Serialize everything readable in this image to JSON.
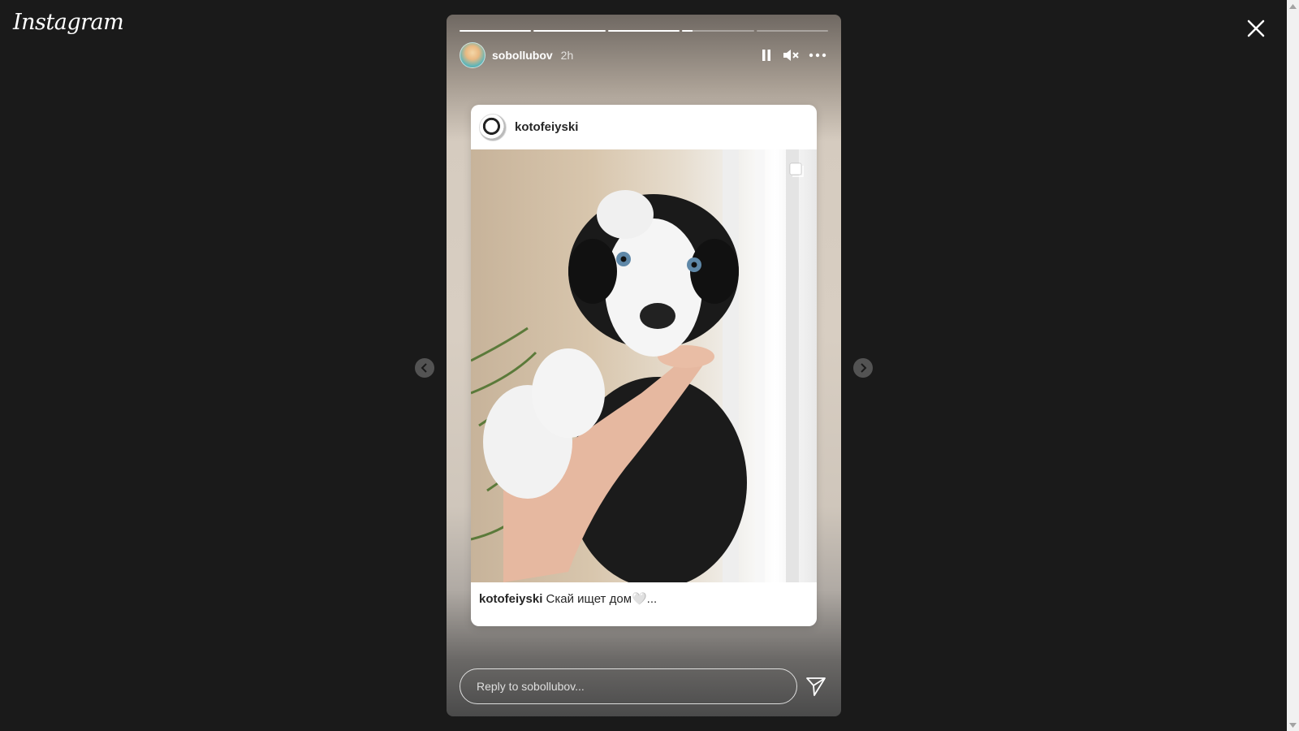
{
  "app": {
    "logo_text": "Instagram"
  },
  "story": {
    "progress": [
      1,
      1,
      1,
      0.15,
      0
    ],
    "author": {
      "username": "sobollubov",
      "time_ago": "2h"
    },
    "shared_post": {
      "username": "kotofeiyski",
      "caption_user": "kotofeiyski",
      "caption_text": "Скай ищет дом🤍..."
    },
    "reply": {
      "placeholder": "Reply to sobollubov..."
    }
  },
  "icons": {
    "close": "close-icon",
    "pause": "pause-icon",
    "mute": "muted-speaker-icon",
    "more": "more-options-icon",
    "carousel": "carousel-icon",
    "prev": "chevron-left-icon",
    "next": "chevron-right-icon",
    "send": "send-icon"
  },
  "colors": {
    "background": "#1a1a1a",
    "text": "#ffffff"
  }
}
